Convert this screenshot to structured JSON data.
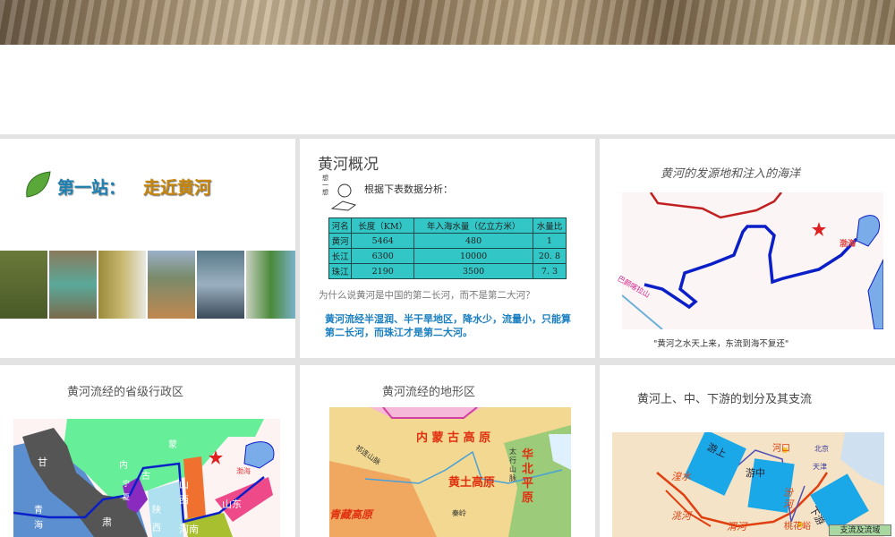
{
  "slides": [
    {
      "title_prefix": "第一站：",
      "title_main": "走近黄河"
    },
    {
      "title": "黄河概况",
      "think_label": "想一想",
      "prompt": "根据下表数据分析：",
      "table": {
        "headers": [
          "河名",
          "长度（KM）",
          "年入海水量（亿立方米）",
          "水量比"
        ],
        "rows": [
          [
            "黄河",
            "5464",
            "480",
            "1"
          ],
          [
            "长江",
            "6300",
            "10000",
            "20. 8"
          ],
          [
            "珠江",
            "2190",
            "3500",
            "7. 3"
          ]
        ]
      },
      "question": "为什么说黄河是中国的第二长河，而不是第二大河？",
      "answer": "黄河流经半湿润、半干旱地区，降水少，流量小，只能算第二长河，而珠江才是第二大河。"
    },
    {
      "title": "黄河的发源地和注入的海洋",
      "map_labels": {
        "sea": "渤海",
        "mountain": "巴颜喀拉山"
      },
      "poem": "\"黄河之水天上来，东流到海不复还\""
    },
    {
      "title": "黄河流经的省级行政区",
      "provinces": [
        "甘",
        "内",
        "蒙",
        "古",
        "宁",
        "夏",
        "青",
        "海",
        "肃",
        "陕",
        "西",
        "山",
        "西",
        "河南",
        "山东",
        "渤海"
      ]
    },
    {
      "title": "黄河流经的地形区",
      "regions": [
        "内 蒙 古 高 原",
        "黄土高原",
        "华北平原",
        "青藏高原",
        "祁连山脉",
        "太行山脉",
        "秦岭"
      ]
    },
    {
      "title": "黄河上、中、下游的划分及其支流",
      "sections": [
        "游上",
        "游中",
        "下游"
      ],
      "labels": [
        "河口",
        "桃花峪",
        "湟水",
        "洮河",
        "渭河",
        "汾河",
        "北京",
        "天津"
      ],
      "legend": "支流及流域"
    }
  ],
  "colors": {
    "river": "#0a1fc8",
    "answer": "#1a7fc0",
    "table": "#33c6c6"
  }
}
